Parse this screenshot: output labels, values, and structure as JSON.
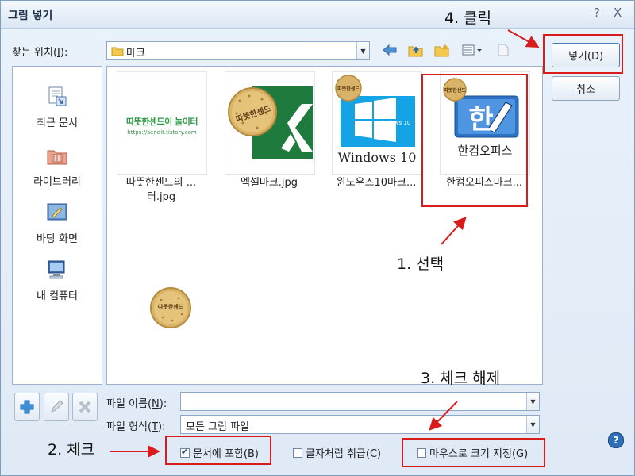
{
  "dialog": {
    "title": "그림 넣기",
    "help_glyph": "?",
    "close_glyph": "X"
  },
  "location": {
    "label_prefix": "찾는 위치(",
    "label_key": "I",
    "label_suffix": "):",
    "value": "마크"
  },
  "places": [
    {
      "label": "최근 문서",
      "icon": "recent-documents-icon"
    },
    {
      "label": "라이브러리",
      "icon": "library-icon"
    },
    {
      "label": "바탕 화면",
      "icon": "desktop-icon"
    },
    {
      "label": "내 컴퓨터",
      "icon": "my-computer-icon"
    }
  ],
  "files": [
    {
      "name_line1": "따뜻한센드의 ...",
      "name_line2": "터.jpg",
      "thumb_text": "따뜻한센드이 놀이터",
      "thumb_sub": "https://sendit.tistory.com"
    },
    {
      "name_line1": "엑셀마크.jpg",
      "name_line2": "",
      "thumb_text": "따뜻한센드"
    },
    {
      "name_line1": "윈도우즈10마크...",
      "name_line2": "",
      "thumb_text": "Windows 10",
      "thumb_small": "Windows 10"
    },
    {
      "name_line1": "한컴오피스마크...",
      "name_line2": "",
      "thumb_text": "한컴오피스",
      "thumb_glyph": "한"
    },
    {
      "name_line1": "",
      "name_line2": "",
      "thumb_text": "따뜻한센드"
    }
  ],
  "badge_text": "따뜻한센드",
  "filename": {
    "label_prefix": "파일 이름(",
    "label_key": "N",
    "label_suffix": "):",
    "value": ""
  },
  "filetype": {
    "label_prefix": "파일 형식(",
    "label_key": "T",
    "label_suffix": "):",
    "value": "모든 그림 파일"
  },
  "buttons": {
    "insert": "넣기(D)",
    "cancel": "취소"
  },
  "options": [
    {
      "label": "문서에 포함(B)",
      "checked": true
    },
    {
      "label": "글자처럼 취급(C)",
      "checked": false
    },
    {
      "label": "마우스로 크기 지정(G)",
      "checked": false
    }
  ],
  "annotations": {
    "step1": "1. 선택",
    "step2": "2. 체크",
    "step3": "3. 체크 해제",
    "step4": "4. 클릭"
  },
  "colors": {
    "annotation_red": "#d81b1b",
    "dialog_bg": "#dfeaf6"
  }
}
